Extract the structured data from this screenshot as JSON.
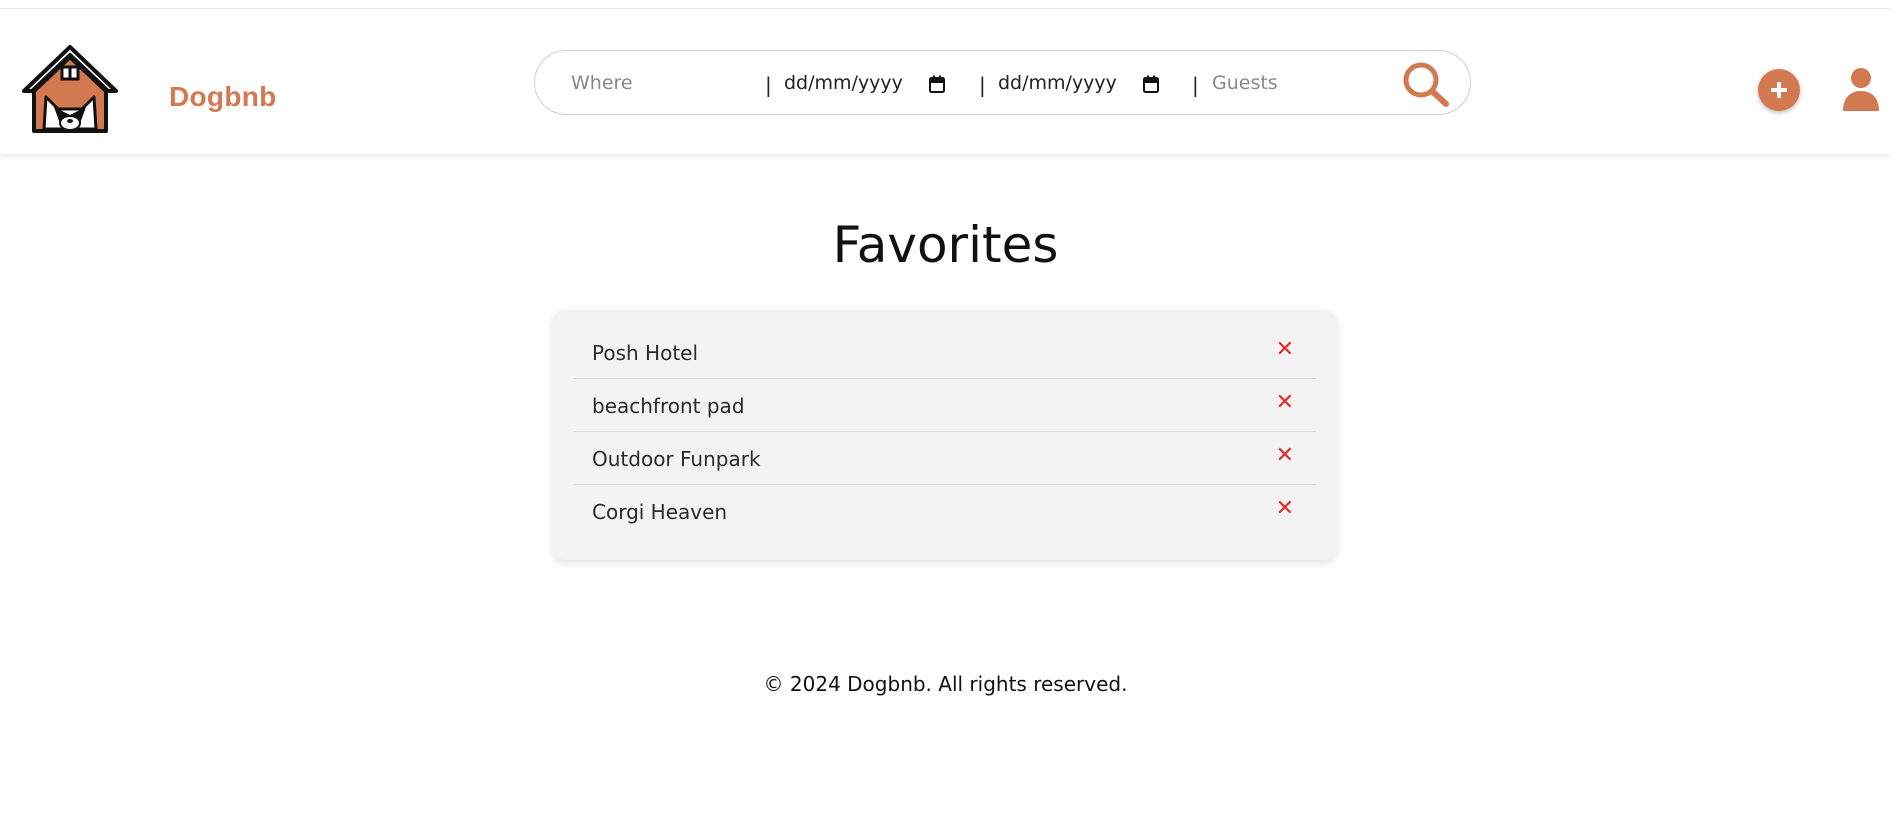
{
  "brand": {
    "name": "Dogbnb",
    "color": "#d27950",
    "logo_icon": "doghouse-logo-icon"
  },
  "search": {
    "where_placeholder": "Where",
    "checkin_value": "dd/mm/yyyy",
    "checkout_value": "dd/mm/yyyy",
    "guests_placeholder": "Guests",
    "separator": "|",
    "search_icon": "magnifier-icon"
  },
  "header_actions": {
    "add_icon": "plus-icon",
    "profile_icon": "user-icon"
  },
  "page": {
    "title": "Favorites"
  },
  "favorites": [
    {
      "name": "Posh Hotel",
      "remove": "✕"
    },
    {
      "name": "beachfront pad",
      "remove": "✕"
    },
    {
      "name": "Outdoor Funpark",
      "remove": "✕"
    },
    {
      "name": "Corgi Heaven",
      "remove": "✕"
    }
  ],
  "footer": {
    "text": "© 2024 Dogbnb. All rights reserved."
  },
  "colors": {
    "accent": "#d27950",
    "remove": "#e02a2a"
  }
}
